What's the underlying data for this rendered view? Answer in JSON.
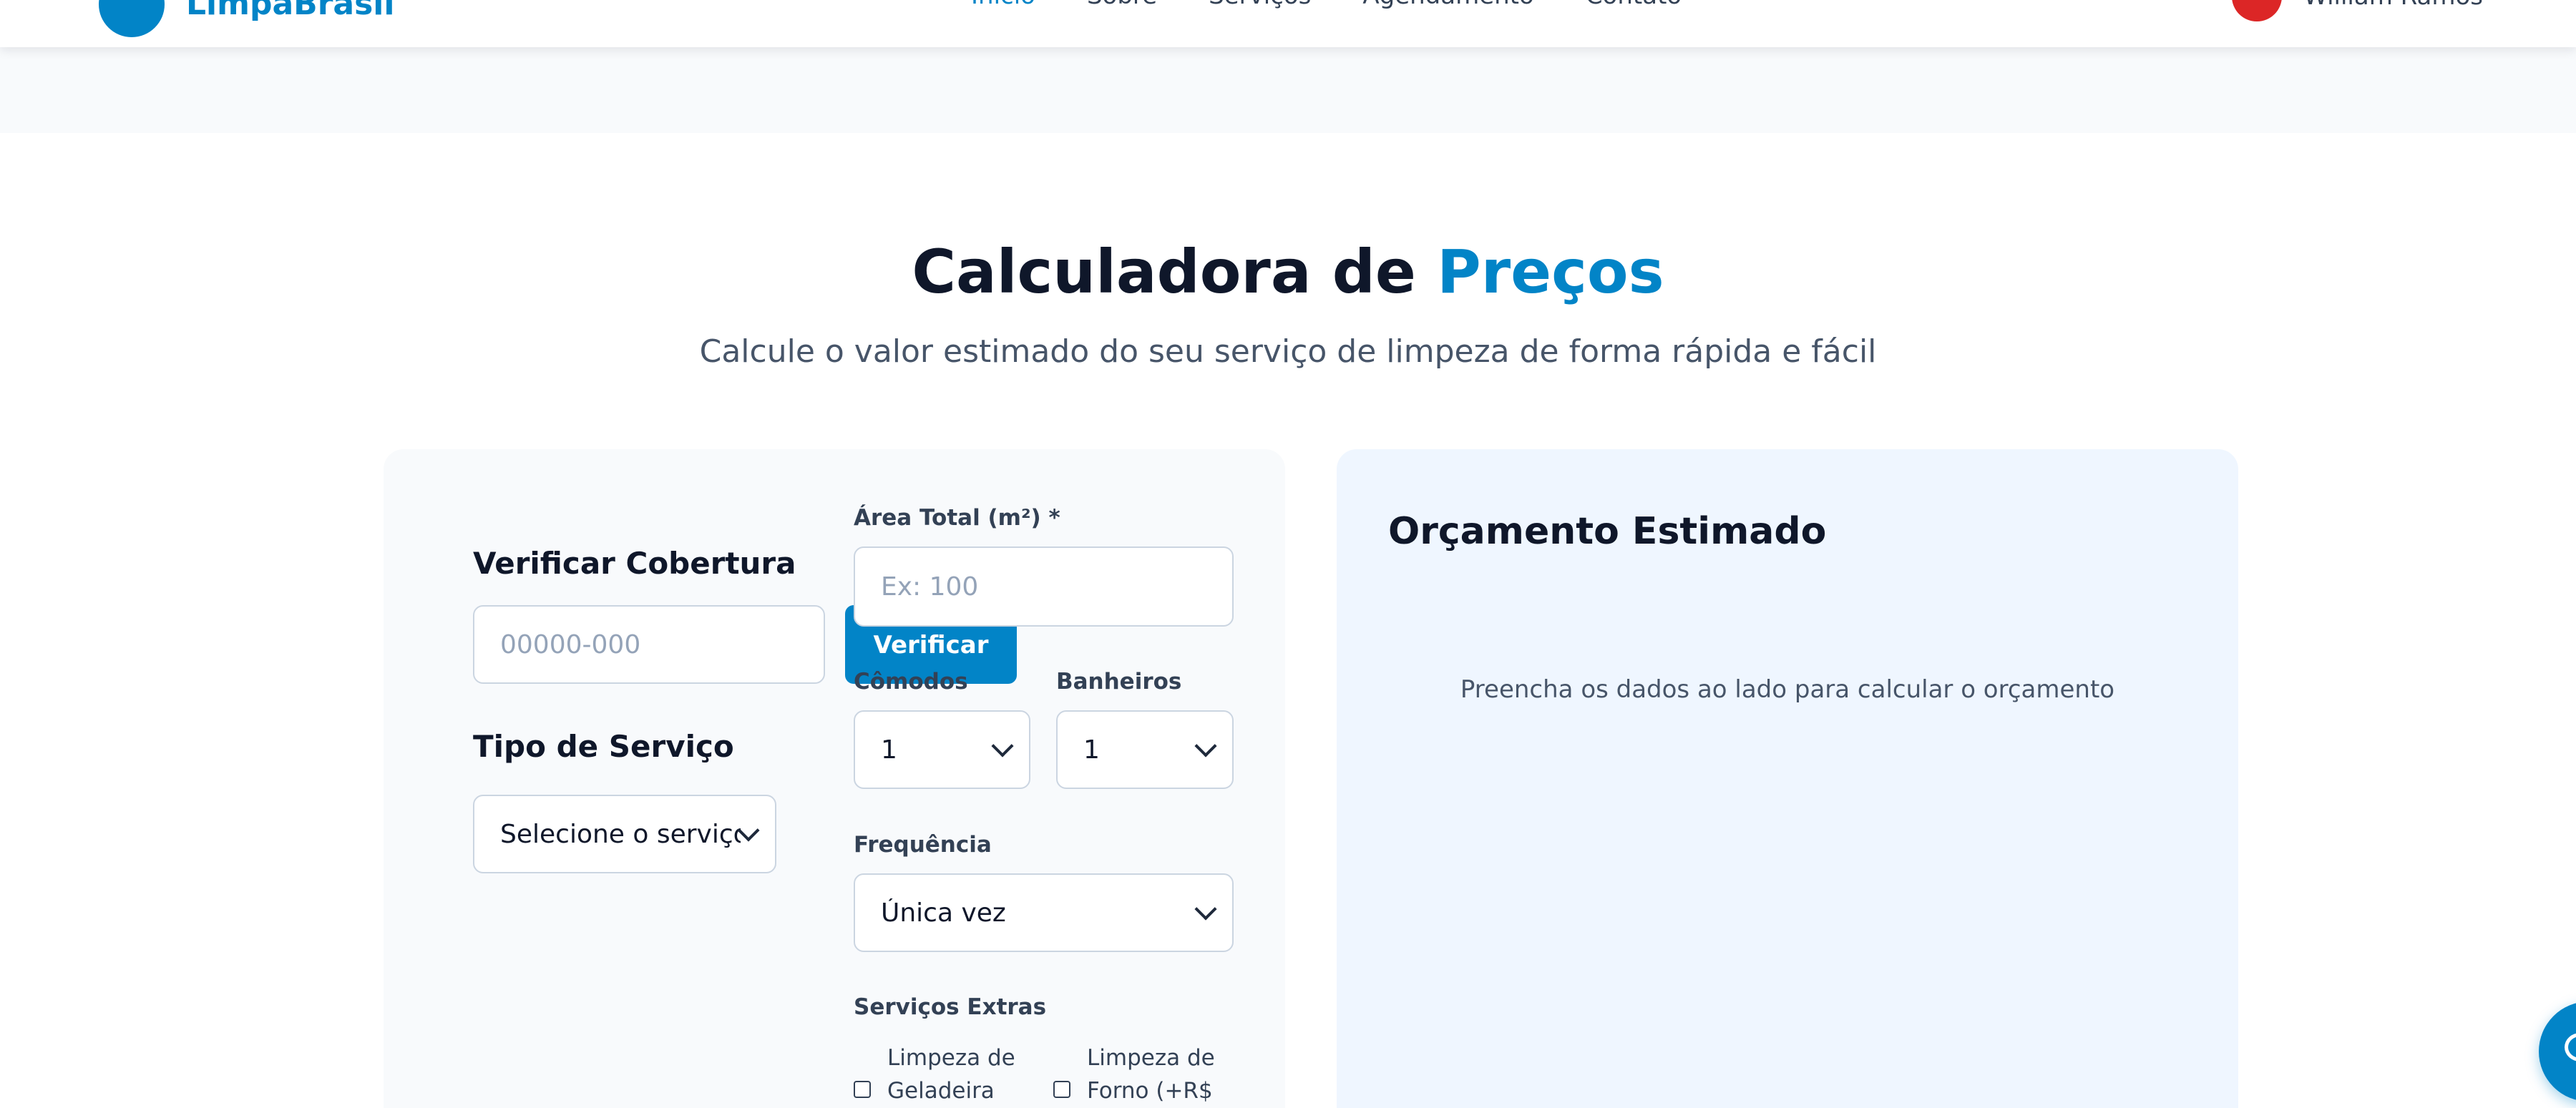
{
  "header": {
    "brand": "LimpaBrasil",
    "nav": [
      "Início",
      "Sobre",
      "Serviços",
      "Agendamento",
      "Contato"
    ],
    "user_name": "William Ramos"
  },
  "hero": {
    "title_main": "Calculadora de",
    "title_accent": "Preços",
    "subtitle": "Calcule o valor estimado do seu serviço de limpeza de forma rápida e fácil"
  },
  "coverage": {
    "title": "Verificar Cobertura",
    "cep_placeholder": "00000-000",
    "button_label": "Verificar"
  },
  "service_type": {
    "title": "Tipo de Serviço",
    "selected": "Selecione o serviço"
  },
  "area": {
    "label": "Área Total (m²) *",
    "placeholder": "Ex: 100"
  },
  "rooms": {
    "label": "Cômodos",
    "selected": "1"
  },
  "bathrooms": {
    "label": "Banheiros",
    "selected": "1"
  },
  "frequency": {
    "label": "Frequência",
    "selected": "Única vez"
  },
  "extras": {
    "label": "Serviços Extras",
    "items": [
      {
        "line1": "Limpeza de",
        "line2": "Geladeira"
      },
      {
        "line1": "Limpeza de",
        "line2": "Forno (+R$"
      }
    ]
  },
  "estimate": {
    "title": "Orçamento Estimado",
    "empty_message": "Preencha os dados ao lado para calcular o orçamento"
  },
  "colors": {
    "accent": "#0284c7",
    "avatar": "#dc2626",
    "panel_left": "#f8fafc",
    "panel_right": "#eff6ff"
  },
  "icons": {
    "chat": "chat-icon",
    "dropdown": "chevron-down-icon"
  }
}
